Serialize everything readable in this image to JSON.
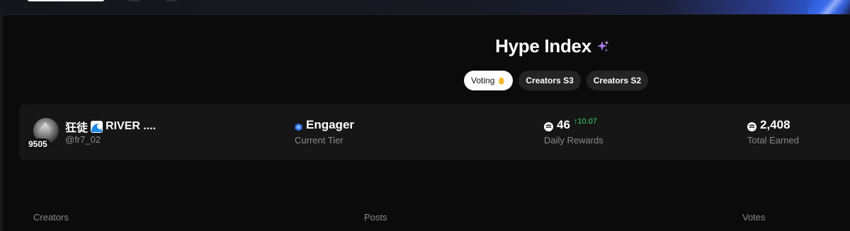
{
  "colors": {
    "background": "#0b0b0b",
    "card": "#161616",
    "tab_inactive": "#242424",
    "tab_active": "#ffffff",
    "positive_delta": "#3ddc6a",
    "muted_text": "#8a8a8a",
    "tier_icon": "#2f6fe8"
  },
  "page": {
    "title": "Hype Index",
    "title_icon": "sparkle-icon"
  },
  "tabs": [
    {
      "label": "Voting",
      "icon": "raised-hand-icon",
      "active": true
    },
    {
      "label": "Creators S3",
      "active": false
    },
    {
      "label": "Creators S2",
      "active": false
    }
  ],
  "profile": {
    "rank": "9505",
    "name_prefix": "狂徒",
    "name_icon": "wave-icon",
    "name_suffix": "RIVER ....",
    "handle": "@fr7_02",
    "tier": {
      "value": "Engager",
      "caption": "Current Tier",
      "icon": "tier-hex-icon"
    },
    "daily_rewards": {
      "value": "46",
      "delta": "↑10.07",
      "caption": "Daily Rewards",
      "icon": "token-icon"
    },
    "total_earned": {
      "value": "2,408",
      "caption": "Total Earned",
      "icon": "token-icon"
    }
  },
  "table": {
    "columns": [
      "Creators",
      "Posts",
      "Votes"
    ]
  }
}
